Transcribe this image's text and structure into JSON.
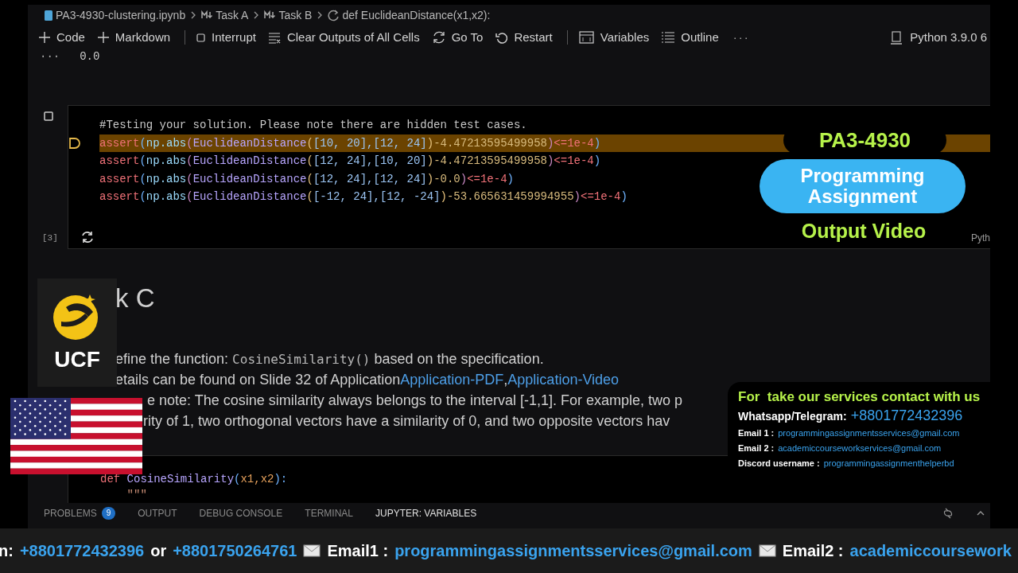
{
  "breadcrumb": [
    {
      "kind": "file",
      "text": "PA3-4930-clustering.ipynb"
    },
    {
      "kind": "markdown",
      "text": "Task A"
    },
    {
      "kind": "markdown",
      "text": "Task B"
    },
    {
      "kind": "function",
      "text": "def EuclideanDistance(x1,x2):"
    }
  ],
  "toolbar": [
    {
      "kind": "plus",
      "text": "Code"
    },
    {
      "kind": "plus",
      "text": "Markdown"
    },
    {
      "kind": "separator"
    },
    {
      "kind": "stop",
      "text": "Interrupt"
    },
    {
      "kind": "clear",
      "text": "Clear Outputs of All Cells"
    },
    {
      "kind": "goto",
      "text": "Go To"
    },
    {
      "kind": "restart",
      "text": "Restart"
    },
    {
      "kind": "separator"
    },
    {
      "kind": "variables",
      "text": "Variables"
    },
    {
      "kind": "outline",
      "text": "Outline"
    },
    {
      "kind": "more",
      "text": "···"
    }
  ],
  "kernel": "Python 3.9.0 6",
  "previous_output": {
    "ellipsis": "···",
    "value": "0.0"
  },
  "cell": {
    "execution_count": "[3]",
    "language": "Pyth",
    "running": true,
    "lines": [
      {
        "highlighted": false,
        "tokens": [
          {
            "kind": "comment",
            "text": "#Testing your solution. Please note there are hidden test cases."
          }
        ]
      },
      {
        "highlighted": true,
        "tokens": [
          {
            "kind": "keyword",
            "text": "assert"
          },
          {
            "kind": "paren",
            "text": "("
          },
          {
            "kind": "name",
            "text": "np.abs"
          },
          {
            "kind": "paren2",
            "text": "("
          },
          {
            "kind": "func",
            "text": "EuclideanDistance"
          },
          {
            "kind": "paren3",
            "text": "("
          },
          {
            "kind": "number",
            "text": "[10, 20],[12, 24]"
          },
          {
            "kind": "paren3",
            "text": ")"
          },
          {
            "kind": "op",
            "text": "-4.47213595499958"
          },
          {
            "kind": "paren2",
            "text": ")"
          },
          {
            "kind": "keyword",
            "text": "<=1e-4"
          },
          {
            "kind": "paren",
            "text": ")"
          }
        ]
      },
      {
        "highlighted": false,
        "tokens": [
          {
            "kind": "keyword",
            "text": "assert"
          },
          {
            "kind": "paren",
            "text": "("
          },
          {
            "kind": "name",
            "text": "np.abs"
          },
          {
            "kind": "paren2",
            "text": "("
          },
          {
            "kind": "func",
            "text": "EuclideanDistance"
          },
          {
            "kind": "paren3",
            "text": "("
          },
          {
            "kind": "number",
            "text": "[12, 24],[10, 20]"
          },
          {
            "kind": "paren3",
            "text": ")"
          },
          {
            "kind": "op",
            "text": "-4.47213595499958"
          },
          {
            "kind": "paren2",
            "text": ")"
          },
          {
            "kind": "keyword",
            "text": "<=1e-4"
          },
          {
            "kind": "paren",
            "text": ")"
          }
        ]
      },
      {
        "highlighted": false,
        "tokens": [
          {
            "kind": "keyword",
            "text": "assert"
          },
          {
            "kind": "paren",
            "text": "("
          },
          {
            "kind": "name",
            "text": "np.abs"
          },
          {
            "kind": "paren2",
            "text": "("
          },
          {
            "kind": "func",
            "text": "EuclideanDistance"
          },
          {
            "kind": "paren3",
            "text": "("
          },
          {
            "kind": "number",
            "text": "[12, 24],[12, 24]"
          },
          {
            "kind": "paren3",
            "text": ")"
          },
          {
            "kind": "op",
            "text": "-0.0"
          },
          {
            "kind": "paren2",
            "text": ")"
          },
          {
            "kind": "keyword",
            "text": "<=1e-4"
          },
          {
            "kind": "paren",
            "text": ")"
          }
        ]
      },
      {
        "highlighted": false,
        "tokens": [
          {
            "kind": "keyword",
            "text": "assert"
          },
          {
            "kind": "paren",
            "text": "("
          },
          {
            "kind": "name",
            "text": "np.abs"
          },
          {
            "kind": "paren2",
            "text": "("
          },
          {
            "kind": "func",
            "text": "EuclideanDistance"
          },
          {
            "kind": "paren3",
            "text": "("
          },
          {
            "kind": "number",
            "text": "[-12, 24],[12, -24]"
          },
          {
            "kind": "paren3",
            "text": ")"
          },
          {
            "kind": "op",
            "text": "-53.665631459994955"
          },
          {
            "kind": "paren2",
            "text": ")"
          },
          {
            "kind": "keyword",
            "text": "<=1e-4"
          },
          {
            "kind": "paren",
            "text": ")"
          }
        ]
      }
    ]
  },
  "markdown": {
    "heading": "k C",
    "line_1": {
      "before": "efine the function: ",
      "code": "CosineSimilarity()",
      "after": " based on the specification."
    },
    "line_2": {
      "before": "etails can be found on Slide 32 of Application ",
      "links": [
        "Application-PDF",
        "Application-Video"
      ],
      "separator": ", "
    },
    "line_3": {
      "rest": "e note: The cosine similarity always belongs to the interval [-1,1]. For example, two p"
    },
    "line_4": "rity of 1, two orthogonal vectors have a similarity of 0, and two opposite vectors hav"
  },
  "code_cell_2": {
    "lines": [
      [
        {
          "kind": "keyword",
          "text": "def "
        },
        {
          "kind": "func2",
          "text": "CosineSimilarity"
        },
        {
          "kind": "paren",
          "text": "("
        },
        {
          "kind": "param",
          "text": "x1,x2"
        },
        {
          "kind": "paren",
          "text": "):"
        }
      ],
      [
        {
          "kind": "string",
          "text": "    \"\"\""
        }
      ]
    ]
  },
  "panel_tabs": [
    {
      "label": "PROBLEMS",
      "badge": "9",
      "selected": false
    },
    {
      "label": "OUTPUT",
      "selected": false
    },
    {
      "label": "DEBUG CONSOLE",
      "selected": false
    },
    {
      "label": "TERMINAL",
      "selected": false
    },
    {
      "label": "JUPYTER: VARIABLES",
      "selected": true
    }
  ],
  "overlay_title": {
    "code": "PA3-4930",
    "label": "Programming Assignment",
    "subtitle": "Output Video"
  },
  "logo": {
    "text": "UCF"
  },
  "contact_box": {
    "heading": "For  take our services contact with us",
    "rows": [
      {
        "label": "Whatsapp/Telegram:",
        "value": "+8801772432396"
      },
      {
        "label": "Email 1 :",
        "value": "programmingassignmentsservices@gmail.com"
      },
      {
        "label": "Email 2 :",
        "value": "academiccourseworkservices@gmail.com"
      },
      {
        "label": "Discord username :",
        "value": "programmingassignmenthelperbd"
      }
    ]
  },
  "ticker": [
    {
      "kind": "label",
      "text": "n:"
    },
    {
      "kind": "link",
      "text": "+8801772432396"
    },
    {
      "kind": "label",
      "text": "or"
    },
    {
      "kind": "link",
      "text": "+8801750264761"
    },
    {
      "kind": "mail"
    },
    {
      "kind": "label",
      "text": "Email1 :"
    },
    {
      "kind": "link",
      "text": "programmingassignmentsservices@gmail.com"
    },
    {
      "kind": "mail"
    },
    {
      "kind": "label",
      "text": "Email2 :"
    },
    {
      "kind": "link",
      "text": "academiccoursework"
    }
  ]
}
